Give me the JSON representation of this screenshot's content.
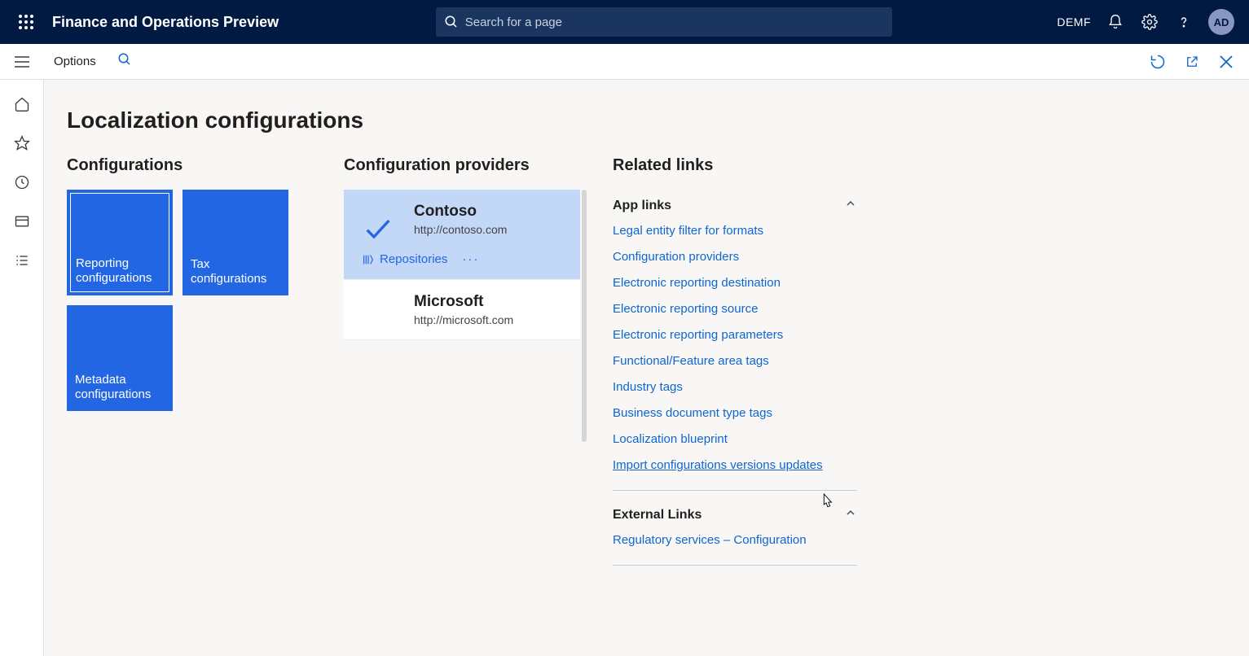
{
  "topnav": {
    "title": "Finance and Operations Preview",
    "search_placeholder": "Search for a page",
    "company": "DEMF",
    "avatar": "AD"
  },
  "actionbar": {
    "options_label": "Options"
  },
  "page": {
    "title": "Localization configurations"
  },
  "configurations": {
    "heading": "Configurations",
    "tiles": [
      {
        "label": "Reporting configurations",
        "selected": true
      },
      {
        "label": "Tax configurations",
        "selected": false
      },
      {
        "label": "Metadata configurations",
        "selected": false
      }
    ]
  },
  "providers": {
    "heading": "Configuration providers",
    "items": [
      {
        "name": "Contoso",
        "url": "http://contoso.com",
        "selected": true,
        "repositories_label": "Repositories"
      },
      {
        "name": "Microsoft",
        "url": "http://microsoft.com",
        "selected": false
      }
    ]
  },
  "related": {
    "heading": "Related links",
    "app_links_heading": "App links",
    "app_links": [
      "Legal entity filter for formats",
      "Configuration providers",
      "Electronic reporting destination",
      "Electronic reporting source",
      "Electronic reporting parameters",
      "Functional/Feature area tags",
      "Industry tags",
      "Business document type tags",
      "Localization blueprint",
      "Import configurations versions updates"
    ],
    "external_links_heading": "External Links",
    "external_links": [
      "Regulatory services – Configuration"
    ]
  }
}
